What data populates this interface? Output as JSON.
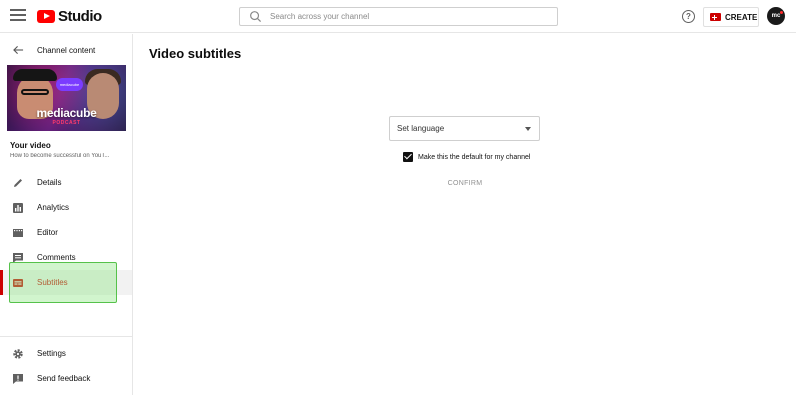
{
  "header": {
    "logo_text": "Studio",
    "search": {
      "placeholder": "Search across your channel",
      "value": ""
    },
    "create_label": "CREATE",
    "avatar_text": "mc"
  },
  "sidebar": {
    "back_label": "Channel content",
    "thumbnail": {
      "bubble_text": "mediacube",
      "title": "mediacube",
      "subtitle": "PODCAST"
    },
    "your_video_label": "Your video",
    "video_title": "How to become successful on YouT...",
    "nav": [
      {
        "label": "Details",
        "icon": "pencil-icon",
        "active": false
      },
      {
        "label": "Analytics",
        "icon": "bar-chart-icon",
        "active": false
      },
      {
        "label": "Editor",
        "icon": "film-icon",
        "active": false
      },
      {
        "label": "Comments",
        "icon": "comment-icon",
        "active": false
      },
      {
        "label": "Subtitles",
        "icon": "subtitles-icon",
        "active": true
      }
    ],
    "bottom_nav": [
      {
        "label": "Settings",
        "icon": "gear-icon"
      },
      {
        "label": "Send feedback",
        "icon": "feedback-icon"
      }
    ]
  },
  "main": {
    "title": "Video subtitles",
    "language_select": {
      "value": "Set language"
    },
    "default_checkbox": {
      "checked": true,
      "label": "Make this the default for my channel"
    },
    "confirm_label": "CONFIRM"
  },
  "colors": {
    "brand_red": "#ff0000",
    "active_red": "#cc0000",
    "highlight_green": "#55c24a"
  }
}
